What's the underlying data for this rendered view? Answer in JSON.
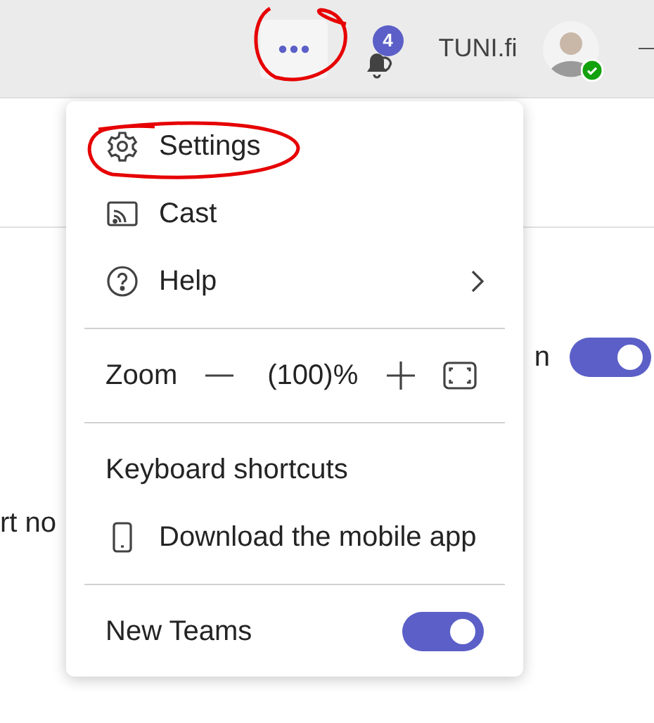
{
  "top_bar": {
    "notification_count": "4",
    "account": "TUNI.fi"
  },
  "background": {
    "setting_text": "n",
    "setting_on": true,
    "text_fragment": "rt no"
  },
  "menu": [
    {
      "kind": "item",
      "label": "Settings",
      "submenu": false
    },
    {
      "kind": "item",
      "label": "Cast",
      "submenu": false
    },
    {
      "kind": "item",
      "label": "Help",
      "submenu": true
    },
    {
      "kind": "divider"
    },
    {
      "kind": "zoom",
      "label": "Zoom",
      "value": "(100)%"
    },
    {
      "kind": "divider"
    },
    {
      "kind": "text",
      "label": "Keyboard shortcuts"
    },
    {
      "kind": "item",
      "label": "Download the mobile app",
      "submenu": false
    },
    {
      "kind": "divider"
    },
    {
      "kind": "toggle",
      "label": "New Teams",
      "on": true
    }
  ]
}
